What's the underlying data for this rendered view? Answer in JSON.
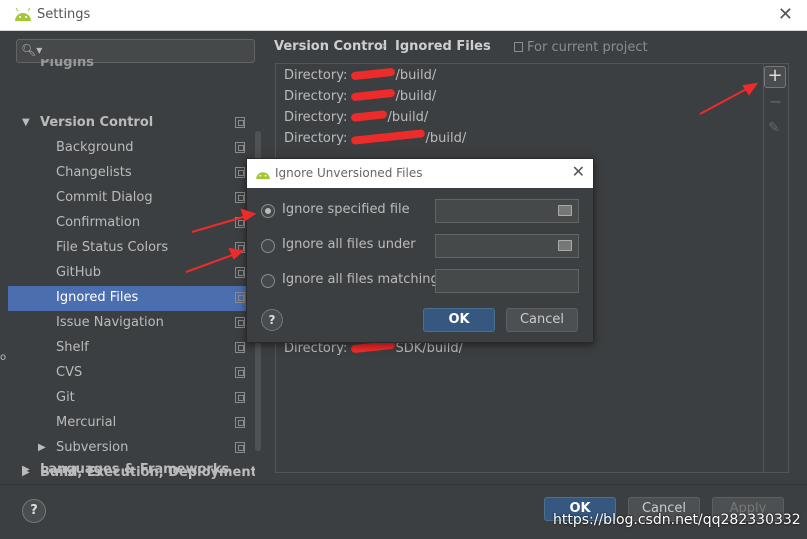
{
  "window": {
    "title": "Settings"
  },
  "search": {
    "placeholder": ""
  },
  "sidebar": {
    "items": [
      {
        "label": "Plugins",
        "level": 0,
        "bold": true,
        "partial": true
      },
      {
        "label": "Version Control",
        "level": 0,
        "bold": true,
        "expanded": true
      },
      {
        "label": "Background",
        "level": 1
      },
      {
        "label": "Changelists",
        "level": 1
      },
      {
        "label": "Commit Dialog",
        "level": 1
      },
      {
        "label": "Confirmation",
        "level": 1
      },
      {
        "label": "File Status Colors",
        "level": 1
      },
      {
        "label": "GitHub",
        "level": 1
      },
      {
        "label": "Ignored Files",
        "level": 1,
        "selected": true
      },
      {
        "label": "Issue Navigation",
        "level": 1
      },
      {
        "label": "Shelf",
        "level": 1
      },
      {
        "label": "CVS",
        "level": 1
      },
      {
        "label": "Git",
        "level": 1
      },
      {
        "label": "Mercurial",
        "level": 1
      },
      {
        "label": "Subversion",
        "level": 1,
        "collapsed": true
      },
      {
        "label": "Build, Execution, Deployment",
        "level": 0,
        "bold": true,
        "collapsed": true
      },
      {
        "label": "Languages & Frameworks",
        "level": 0,
        "bold": true,
        "collapsed": true
      }
    ]
  },
  "breadcrumb": {
    "parent": "Version Control",
    "separator": "›",
    "current": "Ignored Files"
  },
  "project_note": "For current project",
  "ignored_list": {
    "items": [
      {
        "prefix": "Directory: ",
        "suffix": "/build/"
      },
      {
        "prefix": "Directory: ",
        "suffix": "/build/"
      },
      {
        "prefix": "Directory: ",
        "suffix": "/build/"
      },
      {
        "prefix": "Directory: ",
        "suffix": "/build/"
      },
      {
        "prefix": "Directory: ",
        "suffix": "SDK/build/"
      }
    ]
  },
  "list_tools": {
    "add": "+",
    "remove": "−",
    "edit": "✎"
  },
  "buttons": {
    "help": "?",
    "ok": "OK",
    "cancel": "Cancel",
    "apply": "Apply"
  },
  "dialog": {
    "title": "Ignore Unversioned Files",
    "options": [
      {
        "label": "Ignore specified file",
        "checked": true
      },
      {
        "label": "Ignore all files under",
        "checked": false
      },
      {
        "label": "Ignore all files matching",
        "checked": false
      }
    ],
    "help": "?",
    "ok": "OK",
    "cancel": "Cancel"
  },
  "watermark": "https://blog.csdn.net/qq282330332",
  "colors": {
    "selection": "#4b6eaf",
    "primary_button": "#365880",
    "redaction": "#ee2b2b",
    "background": "#3c3f41"
  }
}
